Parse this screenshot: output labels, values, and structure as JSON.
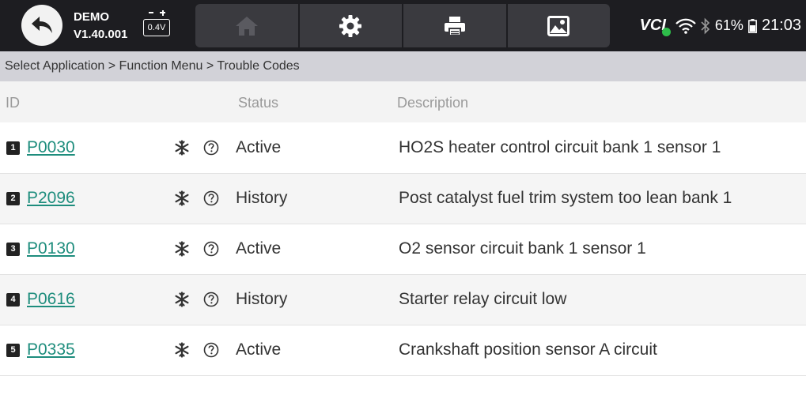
{
  "topbar": {
    "app_name": "DEMO",
    "version": "V1.40.001",
    "battery_voltage": "0.4V",
    "battery_percent": "61%",
    "time": "21:03",
    "vci_label": "VCI"
  },
  "toolbar": {
    "icons": [
      "home-icon",
      "gear-icon",
      "print-icon",
      "image-icon"
    ]
  },
  "breadcrumb": "Select Application > Function Menu > Trouble Codes",
  "table": {
    "headers": {
      "id": "ID",
      "status": "Status",
      "description": "Description"
    },
    "rows": [
      {
        "num": "1",
        "code": "P0030",
        "status": "Active",
        "description": "HO2S heater control circuit bank 1  sensor 1"
      },
      {
        "num": "2",
        "code": "P2096",
        "status": "History",
        "description": "Post catalyst fuel trim system too lean bank 1"
      },
      {
        "num": "3",
        "code": "P0130",
        "status": "Active",
        "description": "O2 sensor circuit bank 1 sensor 1"
      },
      {
        "num": "4",
        "code": "P0616",
        "status": "History",
        "description": "Starter relay circuit low"
      },
      {
        "num": "5",
        "code": "P0335",
        "status": "Active",
        "description": "Crankshaft position sensor A circuit"
      }
    ]
  },
  "colors": {
    "topbar_bg": "#1d1d21",
    "link": "#1e8d7d",
    "vci_ok": "#2ebd4a"
  }
}
